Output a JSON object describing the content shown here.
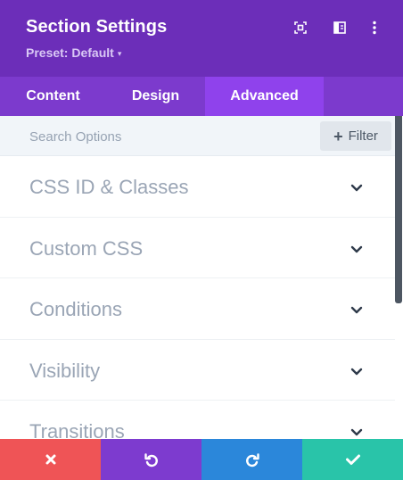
{
  "header": {
    "title": "Section Settings",
    "preset_label": "Preset: Default",
    "preset_caret": "▾",
    "icons": [
      "focus-icon",
      "split-view-icon",
      "more-vertical-icon"
    ]
  },
  "tabs": [
    {
      "label": "Content",
      "active": false
    },
    {
      "label": "Design",
      "active": false
    },
    {
      "label": "Advanced",
      "active": true
    }
  ],
  "search": {
    "placeholder": "Search Options",
    "filter_label": "Filter",
    "filter_icon": "+"
  },
  "groups": [
    {
      "label": "CSS ID & Classes"
    },
    {
      "label": "Custom CSS"
    },
    {
      "label": "Conditions"
    },
    {
      "label": "Visibility"
    },
    {
      "label": "Transitions"
    }
  ],
  "footer": {
    "buttons": [
      "discard",
      "undo",
      "redo",
      "save"
    ],
    "colors": {
      "discard": "#ef5456",
      "undo": "#7d3bcf",
      "redo": "#2b87da",
      "save": "#29c4a9"
    }
  },
  "colors": {
    "header_bg": "#6c2eb9",
    "tabs_bg": "#7c3acd",
    "active_tab_bg": "#8f42ec"
  }
}
